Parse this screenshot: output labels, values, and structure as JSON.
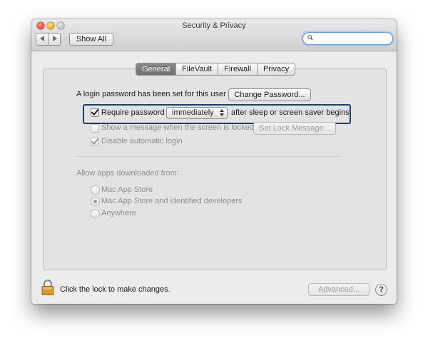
{
  "window": {
    "title": "Security & Privacy"
  },
  "toolbar": {
    "show_all_label": "Show All",
    "search_placeholder": ""
  },
  "tabs": [
    {
      "label": "General",
      "active": true
    },
    {
      "label": "FileVault",
      "active": false
    },
    {
      "label": "Firewall",
      "active": false
    },
    {
      "label": "Privacy",
      "active": false
    }
  ],
  "general": {
    "login_password_text": "A login password has been set for this user",
    "change_password_label": "Change Password...",
    "require_password_label": "Require password",
    "require_password_checked": true,
    "require_password_delay": "immediately",
    "after_sleep_text": "after sleep or screen saver begins",
    "show_message_label": "Show a message when the screen is locked",
    "show_message_checked": false,
    "set_lock_message_label": "Set Lock Message...",
    "disable_auto_login_label": "Disable automatic login",
    "disable_auto_login_checked": true
  },
  "downloads": {
    "heading": "Allow apps downloaded from:",
    "options": [
      {
        "label": "Mac App Store",
        "selected": false
      },
      {
        "label": "Mac App Store and identified developers",
        "selected": true
      },
      {
        "label": "Anywhere",
        "selected": false
      }
    ]
  },
  "footer": {
    "lock_text": "Click the lock to make changes.",
    "advanced_label": "Advanced...",
    "help_label": "?"
  },
  "colors": {
    "highlight_border": "#1d3f63",
    "search_focus": "#6b9ad6"
  }
}
